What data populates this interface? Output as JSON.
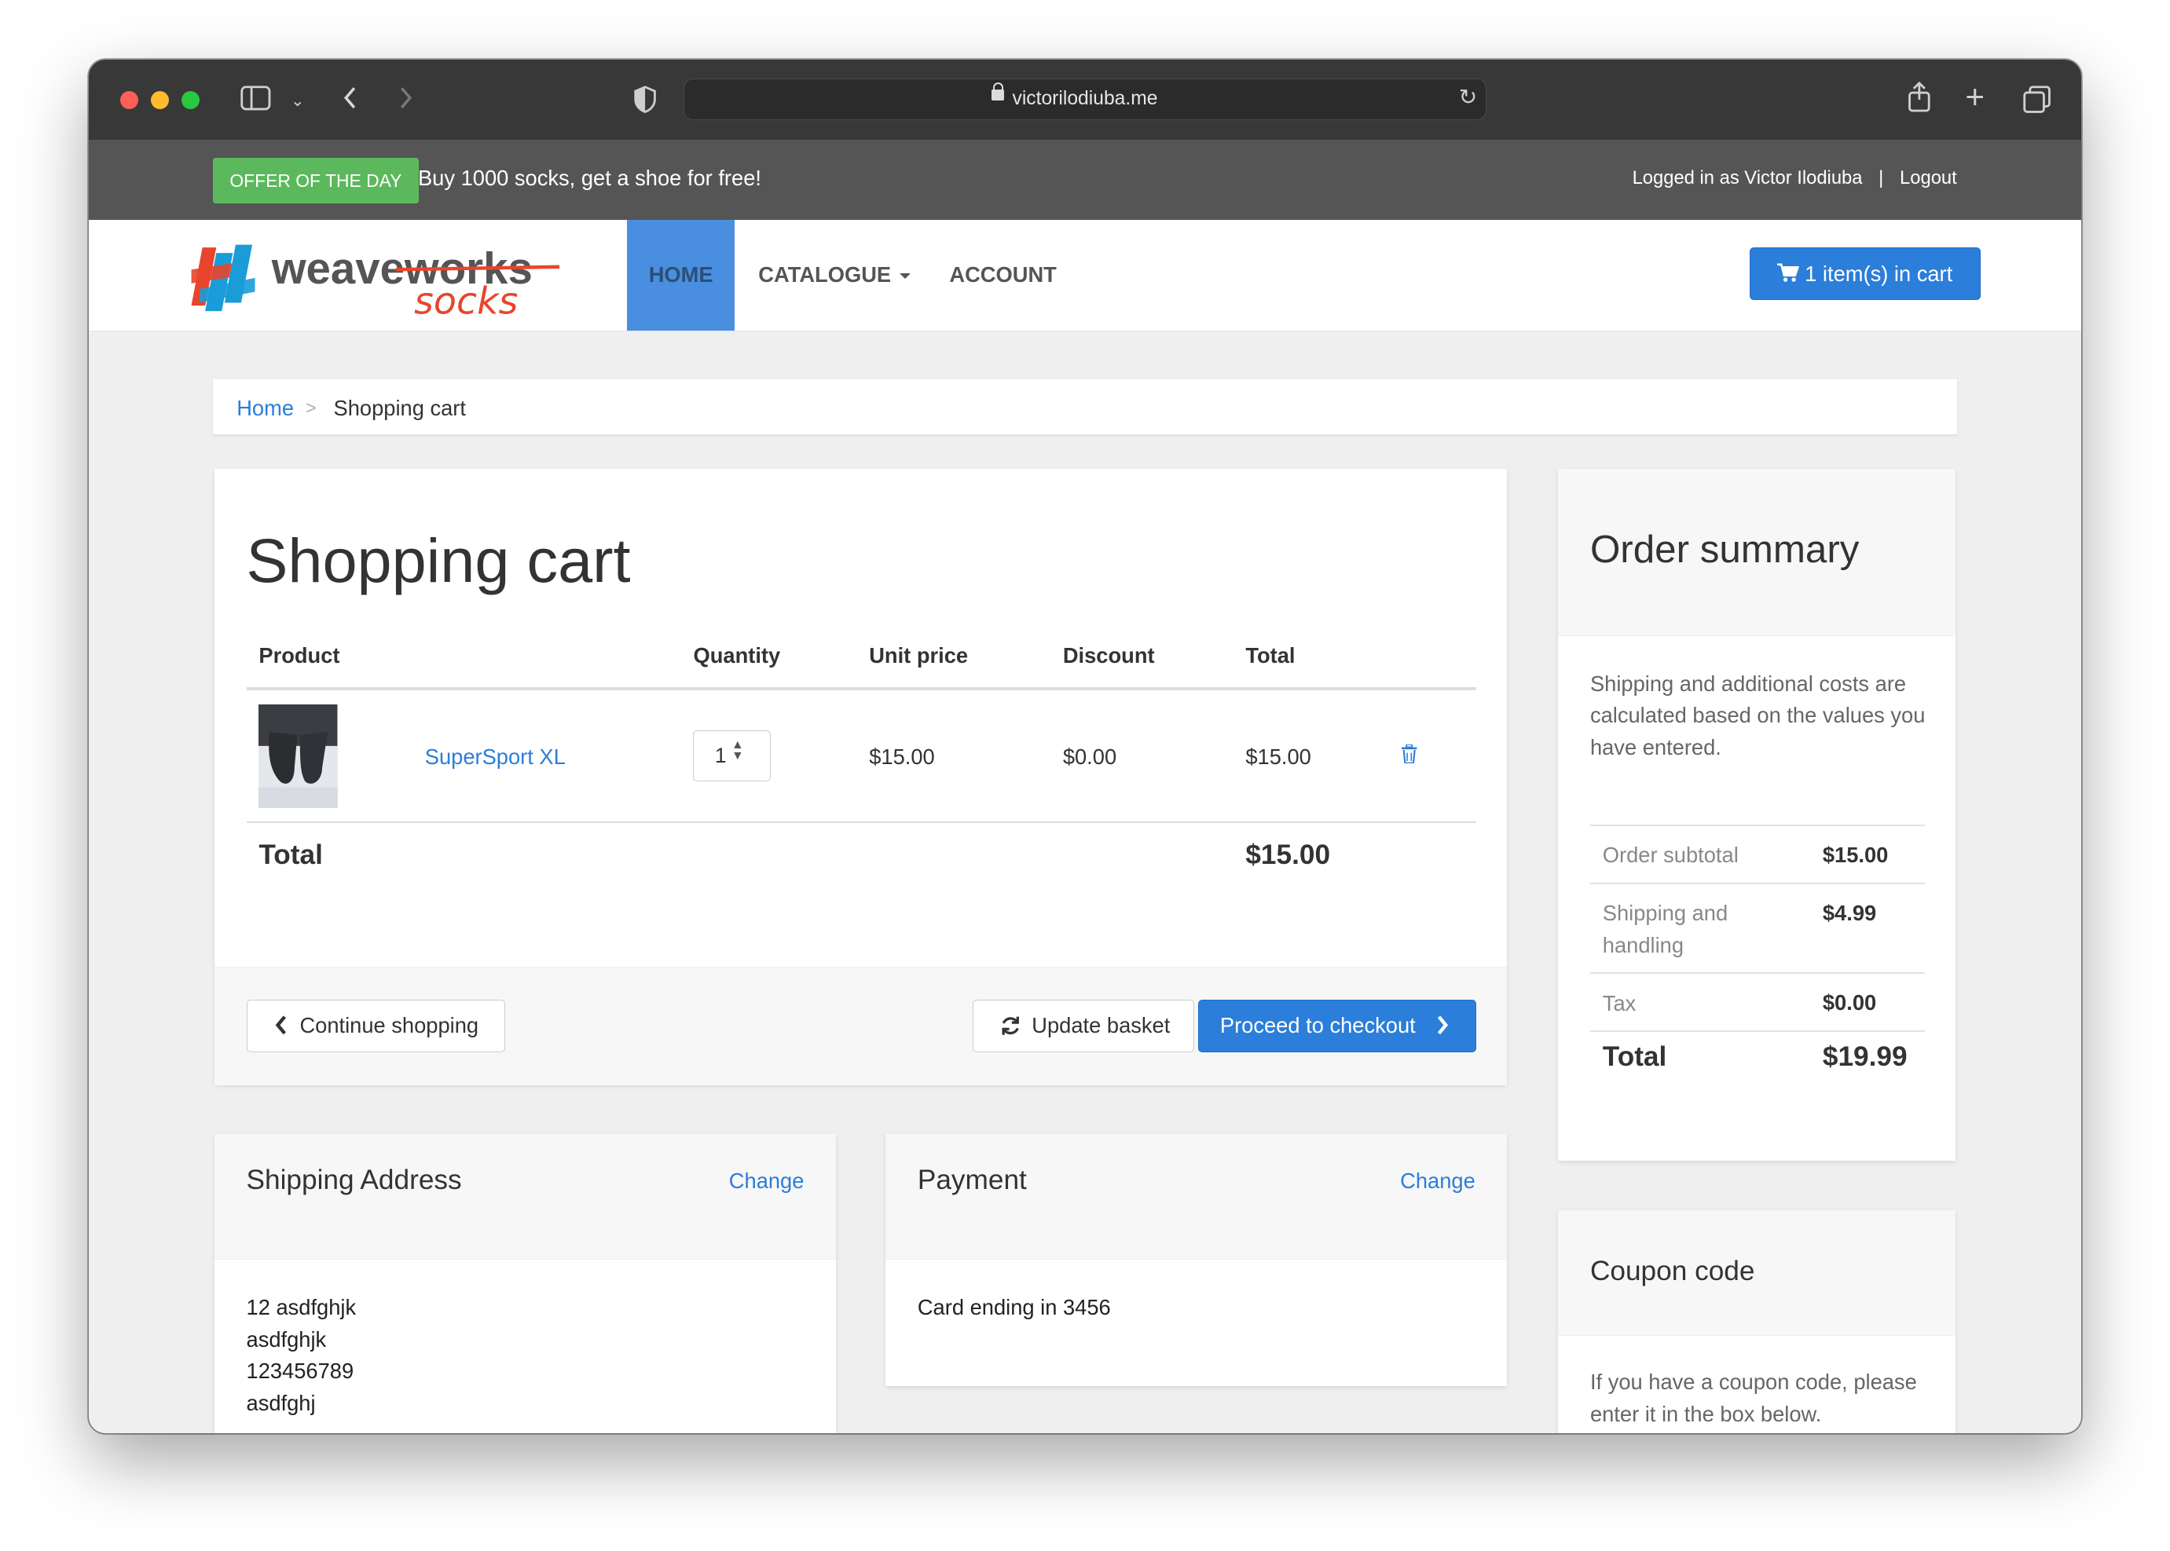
{
  "browser": {
    "url": "victorilodiuba.me"
  },
  "offer": {
    "badge": "OFFER OF THE DAY",
    "text": "Buy 1000 socks, get a shoe for free!"
  },
  "account_bar": {
    "logged_in": "Logged in as Victor Ilodiuba",
    "separator": "|",
    "logout": "Logout"
  },
  "nav": {
    "logo_text_top": "weaveworks",
    "logo_text_bottom": "socks",
    "home": "HOME",
    "catalogue": "CATALOGUE",
    "account": "ACCOUNT",
    "cart_button": "1 item(s) in cart"
  },
  "breadcrumb": {
    "home": "Home",
    "separator": ">",
    "current": "Shopping cart"
  },
  "cart": {
    "title": "Shopping cart",
    "columns": [
      "Product",
      "Quantity",
      "Unit price",
      "Discount",
      "Total"
    ],
    "items": [
      {
        "name": "SuperSport XL",
        "quantity": "1",
        "unit_price": "$15.00",
        "discount": "$0.00",
        "total": "$15.00"
      }
    ],
    "total_label": "Total",
    "total_value": "$15.00",
    "continue_button": "Continue shopping",
    "update_button": "Update basket",
    "checkout_button": "Proceed to checkout"
  },
  "summary": {
    "title": "Order summary",
    "note": "Shipping and additional costs are calculated based on the values you have entered.",
    "rows": [
      {
        "label": "Order subtotal",
        "value": "$15.00"
      },
      {
        "label": "Shipping and handling",
        "value": "$4.99"
      },
      {
        "label": "Tax",
        "value": "$0.00"
      }
    ],
    "total_label": "Total",
    "total_value": "$19.99"
  },
  "coupon": {
    "title": "Coupon code",
    "note": "If you have a coupon code, please enter it in the box below."
  },
  "shipping": {
    "title": "Shipping Address",
    "change": "Change",
    "lines": [
      "12 asdfghjk",
      "asdfghjk",
      "123456789",
      "asdfghj"
    ]
  },
  "payment": {
    "title": "Payment",
    "change": "Change",
    "card": "Card ending in 3456"
  },
  "colors": {
    "accent": "#2b7ed9",
    "offer_badge": "#5cb85c",
    "nav_active": "#4a8fdf",
    "top_bar": "#555555"
  }
}
